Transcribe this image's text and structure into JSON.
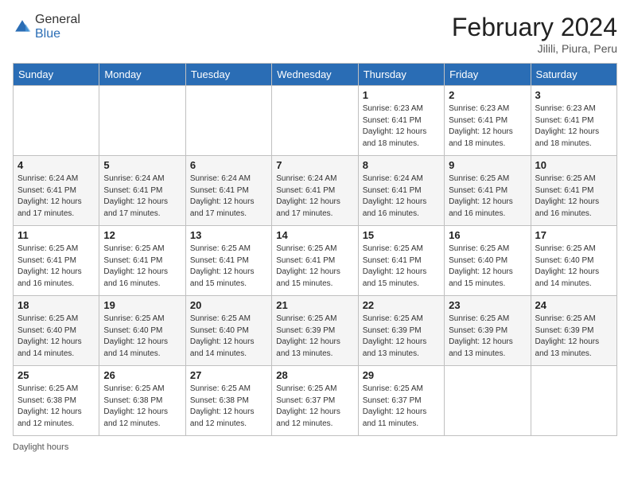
{
  "header": {
    "logo_general": "General",
    "logo_blue": "Blue",
    "month_year": "February 2024",
    "location": "Jilili, Piura, Peru"
  },
  "days_of_week": [
    "Sunday",
    "Monday",
    "Tuesday",
    "Wednesday",
    "Thursday",
    "Friday",
    "Saturday"
  ],
  "weeks": [
    [
      {
        "day": "",
        "info": ""
      },
      {
        "day": "",
        "info": ""
      },
      {
        "day": "",
        "info": ""
      },
      {
        "day": "",
        "info": ""
      },
      {
        "day": "1",
        "info": "Sunrise: 6:23 AM\nSunset: 6:41 PM\nDaylight: 12 hours\nand 18 minutes."
      },
      {
        "day": "2",
        "info": "Sunrise: 6:23 AM\nSunset: 6:41 PM\nDaylight: 12 hours\nand 18 minutes."
      },
      {
        "day": "3",
        "info": "Sunrise: 6:23 AM\nSunset: 6:41 PM\nDaylight: 12 hours\nand 18 minutes."
      }
    ],
    [
      {
        "day": "4",
        "info": "Sunrise: 6:24 AM\nSunset: 6:41 PM\nDaylight: 12 hours\nand 17 minutes."
      },
      {
        "day": "5",
        "info": "Sunrise: 6:24 AM\nSunset: 6:41 PM\nDaylight: 12 hours\nand 17 minutes."
      },
      {
        "day": "6",
        "info": "Sunrise: 6:24 AM\nSunset: 6:41 PM\nDaylight: 12 hours\nand 17 minutes."
      },
      {
        "day": "7",
        "info": "Sunrise: 6:24 AM\nSunset: 6:41 PM\nDaylight: 12 hours\nand 17 minutes."
      },
      {
        "day": "8",
        "info": "Sunrise: 6:24 AM\nSunset: 6:41 PM\nDaylight: 12 hours\nand 16 minutes."
      },
      {
        "day": "9",
        "info": "Sunrise: 6:25 AM\nSunset: 6:41 PM\nDaylight: 12 hours\nand 16 minutes."
      },
      {
        "day": "10",
        "info": "Sunrise: 6:25 AM\nSunset: 6:41 PM\nDaylight: 12 hours\nand 16 minutes."
      }
    ],
    [
      {
        "day": "11",
        "info": "Sunrise: 6:25 AM\nSunset: 6:41 PM\nDaylight: 12 hours\nand 16 minutes."
      },
      {
        "day": "12",
        "info": "Sunrise: 6:25 AM\nSunset: 6:41 PM\nDaylight: 12 hours\nand 16 minutes."
      },
      {
        "day": "13",
        "info": "Sunrise: 6:25 AM\nSunset: 6:41 PM\nDaylight: 12 hours\nand 15 minutes."
      },
      {
        "day": "14",
        "info": "Sunrise: 6:25 AM\nSunset: 6:41 PM\nDaylight: 12 hours\nand 15 minutes."
      },
      {
        "day": "15",
        "info": "Sunrise: 6:25 AM\nSunset: 6:41 PM\nDaylight: 12 hours\nand 15 minutes."
      },
      {
        "day": "16",
        "info": "Sunrise: 6:25 AM\nSunset: 6:40 PM\nDaylight: 12 hours\nand 15 minutes."
      },
      {
        "day": "17",
        "info": "Sunrise: 6:25 AM\nSunset: 6:40 PM\nDaylight: 12 hours\nand 14 minutes."
      }
    ],
    [
      {
        "day": "18",
        "info": "Sunrise: 6:25 AM\nSunset: 6:40 PM\nDaylight: 12 hours\nand 14 minutes."
      },
      {
        "day": "19",
        "info": "Sunrise: 6:25 AM\nSunset: 6:40 PM\nDaylight: 12 hours\nand 14 minutes."
      },
      {
        "day": "20",
        "info": "Sunrise: 6:25 AM\nSunset: 6:40 PM\nDaylight: 12 hours\nand 14 minutes."
      },
      {
        "day": "21",
        "info": "Sunrise: 6:25 AM\nSunset: 6:39 PM\nDaylight: 12 hours\nand 13 minutes."
      },
      {
        "day": "22",
        "info": "Sunrise: 6:25 AM\nSunset: 6:39 PM\nDaylight: 12 hours\nand 13 minutes."
      },
      {
        "day": "23",
        "info": "Sunrise: 6:25 AM\nSunset: 6:39 PM\nDaylight: 12 hours\nand 13 minutes."
      },
      {
        "day": "24",
        "info": "Sunrise: 6:25 AM\nSunset: 6:39 PM\nDaylight: 12 hours\nand 13 minutes."
      }
    ],
    [
      {
        "day": "25",
        "info": "Sunrise: 6:25 AM\nSunset: 6:38 PM\nDaylight: 12 hours\nand 12 minutes."
      },
      {
        "day": "26",
        "info": "Sunrise: 6:25 AM\nSunset: 6:38 PM\nDaylight: 12 hours\nand 12 minutes."
      },
      {
        "day": "27",
        "info": "Sunrise: 6:25 AM\nSunset: 6:38 PM\nDaylight: 12 hours\nand 12 minutes."
      },
      {
        "day": "28",
        "info": "Sunrise: 6:25 AM\nSunset: 6:37 PM\nDaylight: 12 hours\nand 12 minutes."
      },
      {
        "day": "29",
        "info": "Sunrise: 6:25 AM\nSunset: 6:37 PM\nDaylight: 12 hours\nand 11 minutes."
      },
      {
        "day": "",
        "info": ""
      },
      {
        "day": "",
        "info": ""
      }
    ]
  ],
  "footer": {
    "daylight_label": "Daylight hours"
  }
}
